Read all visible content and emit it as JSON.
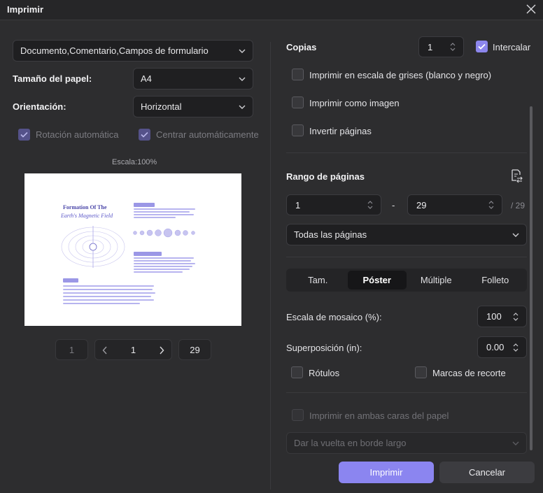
{
  "window": {
    "title": "Imprimir"
  },
  "left": {
    "content_select": "Documento,Comentario,Campos de formulario",
    "paper_size_label": "Tamaño del papel:",
    "paper_size_value": "A4",
    "orientation_label": "Orientación:",
    "orientation_value": "Horizontal",
    "auto_rotate_label": "Rotación automática",
    "auto_center_label": "Centrar automáticamente",
    "scale_label": "Escala:100%",
    "preview": {
      "title": "Formation Of The",
      "subtitle": "Earth's Magnetic Field"
    },
    "pager": {
      "first": "1",
      "current": "1",
      "last": "29"
    }
  },
  "right": {
    "copies_label": "Copias",
    "copies_value": "1",
    "collate_label": "Intercalar",
    "grayscale_label": "Imprimir en escala de grises (blanco y negro)",
    "as_image_label": "Imprimir como imagen",
    "invert_label": "Invertir páginas",
    "range_label": "Rango de páginas",
    "range_from": "1",
    "range_dash": "-",
    "range_to": "29",
    "range_total": "/ 29",
    "range_select": "Todas las páginas",
    "tabs": [
      "Tam.",
      "Póster",
      "Múltiple",
      "Folleto"
    ],
    "tile_scale_label": "Escala de mosaico (%):",
    "tile_scale_value": "100",
    "overlap_label": "Superposición (in):",
    "overlap_value": "0.00",
    "labels_label": "Rótulos",
    "crop_marks_label": "Marcas de recorte",
    "duplex_label": "Imprimir en ambas caras del papel",
    "flip_select": "Dar la vuelta en borde largo",
    "print_button": "Imprimir",
    "cancel_button": "Cancelar"
  },
  "colors": {
    "accent": "#8b85f0",
    "background": "#2d2d2f",
    "field": "#1f1f21"
  }
}
